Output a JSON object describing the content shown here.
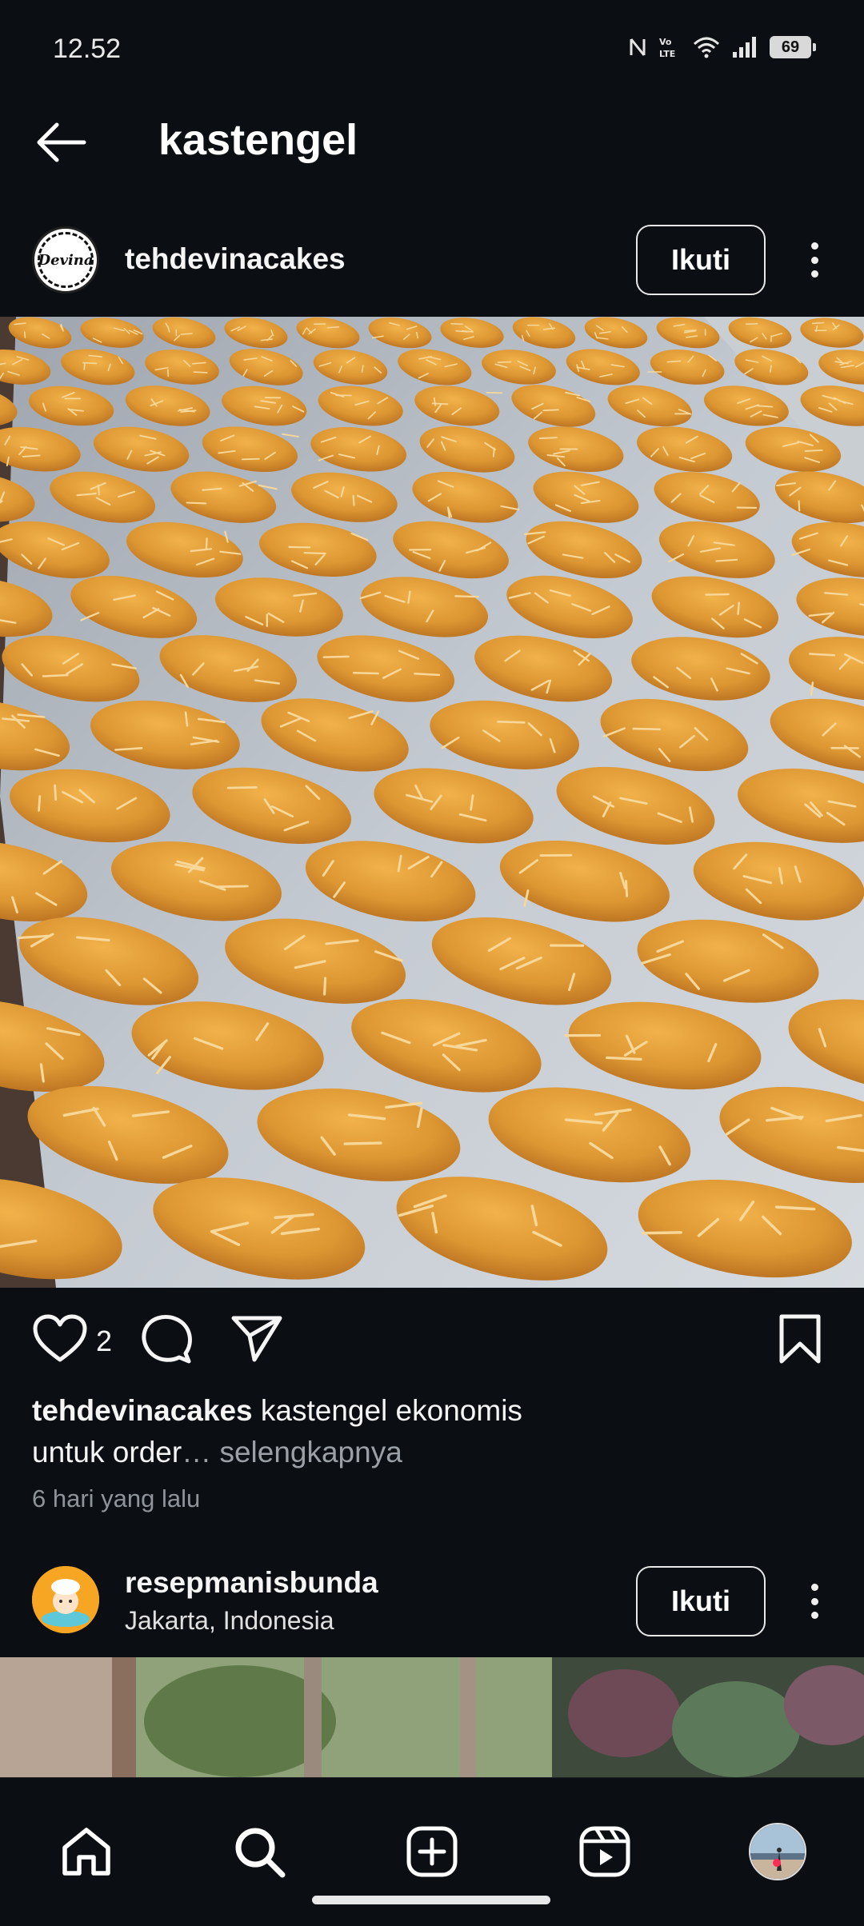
{
  "status_bar": {
    "time": "12.52",
    "battery": "69",
    "lte_label": "LTE",
    "volte_label": "VoLTE"
  },
  "header": {
    "title": "kastengel"
  },
  "post1": {
    "username": "tehdevinacakes",
    "avatar_text": "Devina",
    "follow_label": "Ikuti",
    "like_count": "2",
    "caption_user": "tehdevinacakes",
    "caption_line1": " kastengel ekonomis",
    "caption_line2": "untuk order",
    "caption_more": "… selengkapnya",
    "timestamp": "6 hari yang lalu"
  },
  "post2": {
    "username": "resepmanisbunda",
    "location": "Jakarta, Indonesia",
    "follow_label": "Ikuti"
  },
  "colors": {
    "background": "#0b0f14",
    "text": "#f5f5f5",
    "muted": "#8e949a",
    "notification_dot": "#ff2d55"
  },
  "icons": {
    "back": "arrow-left-icon",
    "more": "more-vertical-icon",
    "like": "heart-icon",
    "comment": "comment-icon",
    "share": "send-icon",
    "save": "bookmark-icon",
    "nav": [
      "home-icon",
      "search-icon",
      "add-post-icon",
      "reels-icon",
      "profile-avatar"
    ]
  }
}
